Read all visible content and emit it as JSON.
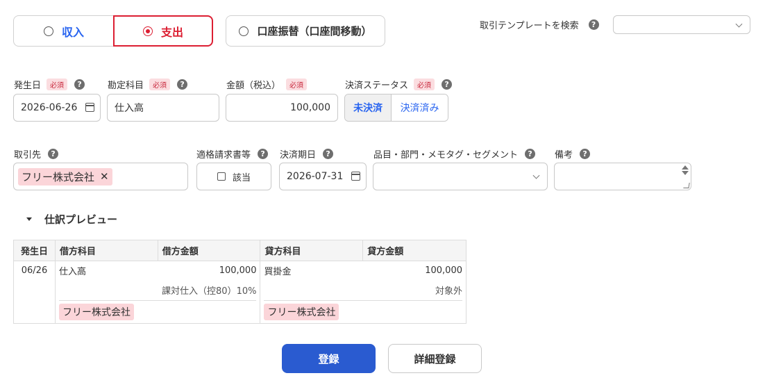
{
  "type_selector": {
    "income": "収入",
    "expense": "支出",
    "transfer": "口座振替（口座間移動）"
  },
  "template_search": {
    "label": "取引テンプレートを検索",
    "value": ""
  },
  "required_badge": "必須",
  "help_glyph": "?",
  "fields": {
    "date": {
      "label": "発生日",
      "value": "2026-06-26"
    },
    "account": {
      "label": "勘定科目",
      "value": "仕入高"
    },
    "amount": {
      "label": "金額（税込）",
      "value": "100,000"
    },
    "status": {
      "label": "決済ステータス",
      "options": [
        "未決済",
        "決済済み"
      ],
      "selected": "未決済"
    },
    "partner": {
      "label": "取引先",
      "tag": "フリー株式会社"
    },
    "invoice": {
      "label": "適格請求書等",
      "checkbox_label": "該当",
      "checked": false
    },
    "due_date": {
      "label": "決済期日",
      "value": "2026-07-31"
    },
    "items": {
      "label": "品目・部門・メモタグ・セグメント",
      "value": ""
    },
    "memo": {
      "label": "備考",
      "value": ""
    }
  },
  "preview": {
    "title": "仕訳プレビュー",
    "headers": [
      "発生日",
      "借方科目",
      "借方金額",
      "貸方科目",
      "貸方金額"
    ],
    "row": {
      "date": "06/26",
      "debit_account": "仕入高",
      "debit_amount": "100,000",
      "debit_tax": "課対仕入（控80）10%",
      "debit_tag": "フリー株式会社",
      "credit_account": "買掛金",
      "credit_amount": "100,000",
      "credit_tax": "対象外",
      "credit_tag": "フリー株式会社"
    }
  },
  "buttons": {
    "register": "登録",
    "detail_register": "詳細登録"
  },
  "colors": {
    "income_blue": "#2864f0",
    "expense_red": "#dc1e32",
    "primary_button": "#2a5bd0",
    "tag_pink": "#fbd5d9"
  }
}
